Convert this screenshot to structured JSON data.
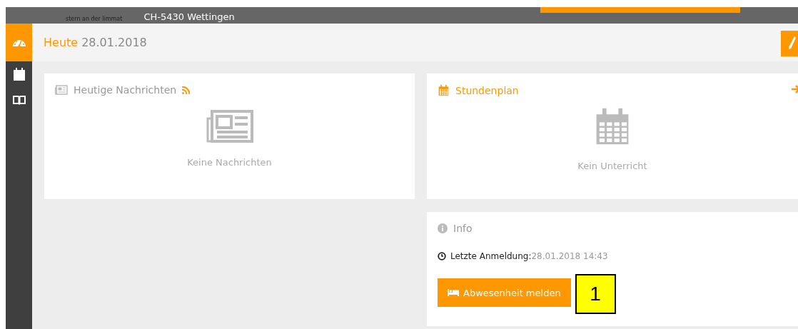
{
  "header": {
    "logo_tagline": "stern an der limmat",
    "address": "CH-5430 Wettingen"
  },
  "sidebar": {
    "items": [
      {
        "kind": "gauge",
        "selected": true
      },
      {
        "kind": "calendar",
        "selected": false
      },
      {
        "kind": "book",
        "selected": false
      }
    ]
  },
  "title_bar": {
    "label": "Heute",
    "date": "28.01.2018"
  },
  "news_card": {
    "title": "Heutige Nachrichten",
    "empty_text": "Keine Nachrichten"
  },
  "schedule_card": {
    "title": "Stundenplan",
    "empty_text": "Kein Unterricht"
  },
  "info_card": {
    "title": "Info",
    "last_login_label": "Letzte Anmeldung:",
    "last_login_value": "28.01.2018 14:43",
    "button": "Abwesenheit melden"
  },
  "callout": {
    "number": "1"
  }
}
